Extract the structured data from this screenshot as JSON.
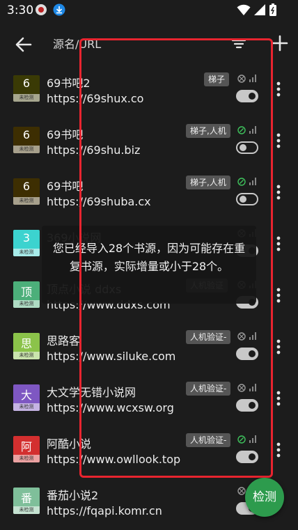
{
  "status_bar": {
    "time": "3:30"
  },
  "toolbar": {
    "title": "源名/URL"
  },
  "sources": [
    {
      "cover_char": "6",
      "cover_color": "#3a3a05",
      "cover_tag": "未检测",
      "name": "69书吧2",
      "url": "https://69shux.co",
      "badge": "梯子",
      "status": "unchecked",
      "enabled": true
    },
    {
      "cover_char": "6",
      "cover_color": "#3d2e02",
      "cover_tag": "未检测",
      "name": "69书吧",
      "url": "https://69shu.biz",
      "badge": "梯子,人机",
      "status": "ok",
      "enabled": false
    },
    {
      "cover_char": "6",
      "cover_color": "#3d2e02",
      "cover_tag": "未检测",
      "name": "69书吧",
      "url": "https://69shuba.cx",
      "badge": "梯子,人机",
      "status": "ok",
      "enabled": false
    },
    {
      "cover_char": "3",
      "cover_color": "#3cd3cf",
      "cover_tag": "未检测",
      "name": "369小说网",
      "url": "",
      "badge": "",
      "status": "unchecked",
      "enabled": true
    },
    {
      "cover_char": "顶",
      "cover_color": "#4caf7a",
      "cover_tag": "未检测",
      "name": "顶点小说 ddxs",
      "url": "https://www.ddxs.com",
      "badge": "人机验证",
      "status": "unchecked",
      "enabled": true
    },
    {
      "cover_char": "思",
      "cover_color": "#8bc34a",
      "cover_tag": "未检测",
      "name": "思路客",
      "url": "https://www.siluke.com",
      "badge": "人机验证-",
      "status": "unchecked",
      "enabled": true
    },
    {
      "cover_char": "大",
      "cover_color": "#7e57c2",
      "cover_tag": "未检测",
      "name": "大文学无错小说网",
      "url": "https://www.wcxsw.org",
      "badge": "人机验证-",
      "status": "unchecked",
      "enabled": true
    },
    {
      "cover_char": "阿",
      "cover_color": "#d32f2f",
      "cover_tag": "未检测",
      "name": "阿酷小说",
      "url": "https://www.owllook.top",
      "badge": "人机验证-",
      "status": "ok",
      "enabled": true
    },
    {
      "cover_char": "番",
      "cover_color": "#7fbf9a",
      "cover_tag": "未检测",
      "name": "番茄小说2",
      "url": "https://fqapi.komr.cn",
      "badge": "",
      "status": "unchecked",
      "enabled": true
    }
  ],
  "toast": {
    "message": "您已经导入28个书源，因为可能存在重复书源，实际增量或小于28个。"
  },
  "fab": {
    "label": "检测"
  },
  "colors": {
    "ok": "#3ec25c",
    "muted": "#9a9a9a",
    "fab": "#2d9b4d",
    "highlight": "#e8242f"
  }
}
